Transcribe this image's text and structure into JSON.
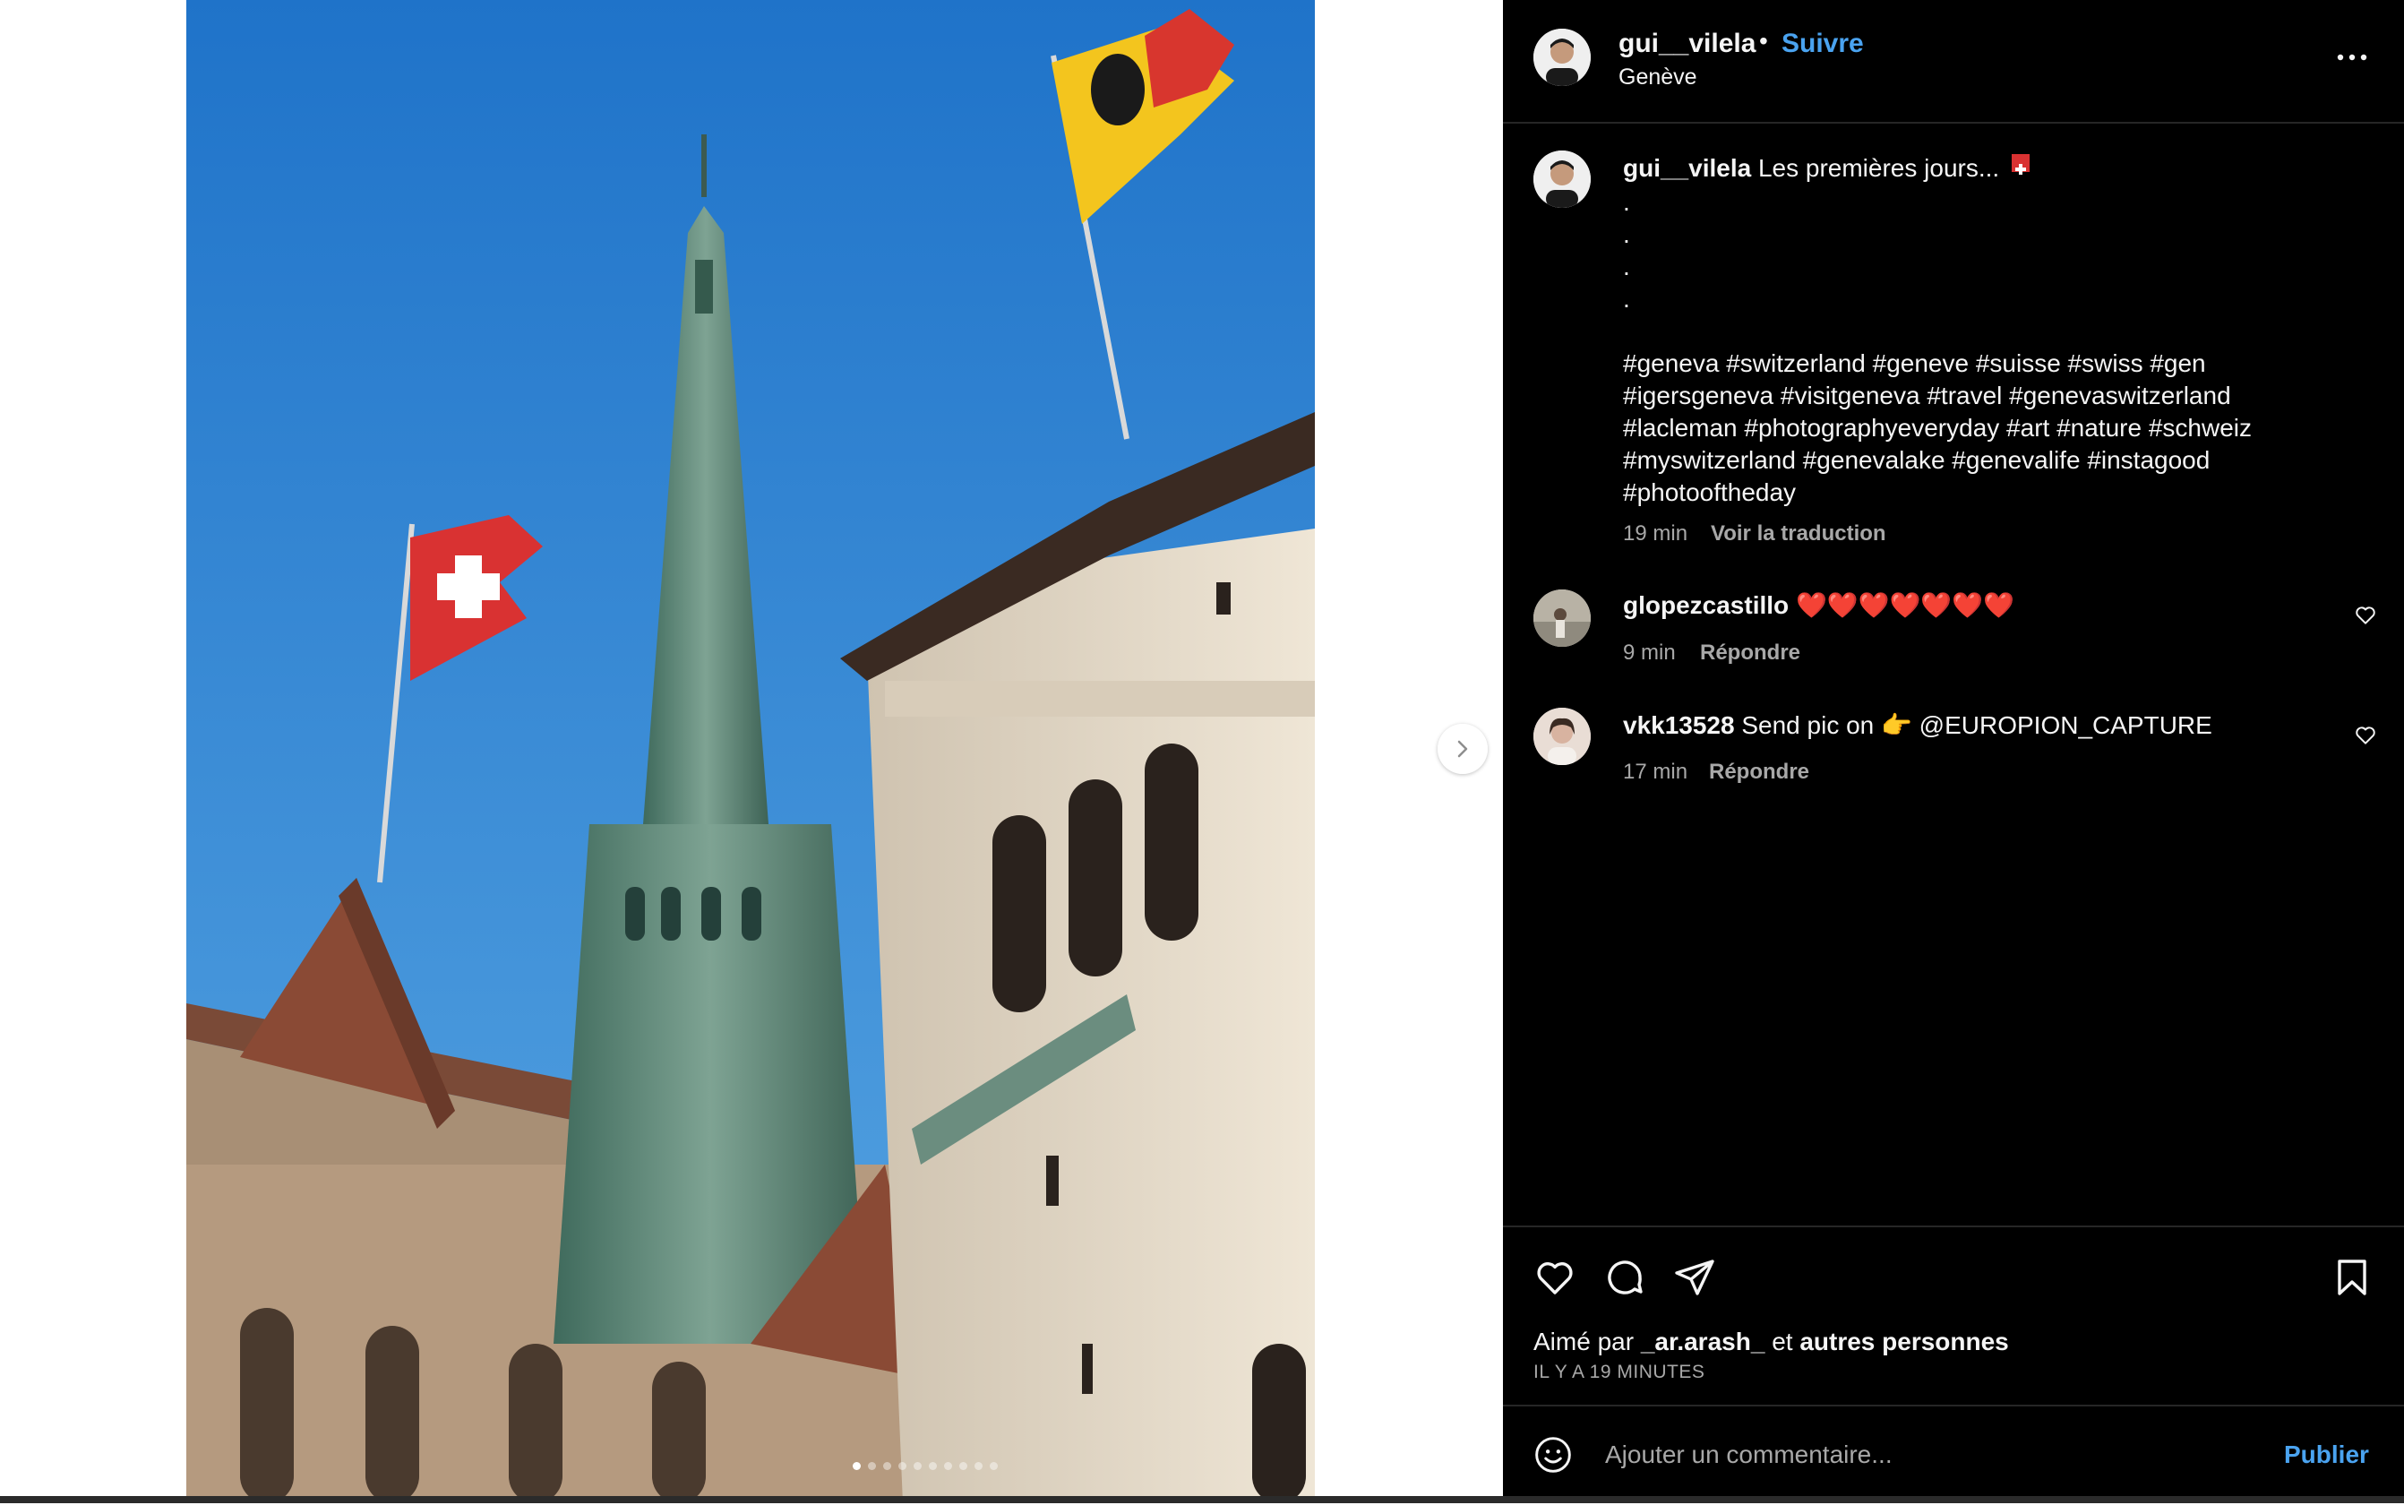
{
  "post": {
    "username": "gui__vilela",
    "separator": "•",
    "follow_label": "Suivre",
    "location": "Genève"
  },
  "caption": {
    "username": "gui__vilela",
    "text": "Les premières jours...",
    "flag_icon": "swiss-flag-emoji",
    "dots": [
      ".",
      ".",
      ".",
      "."
    ],
    "hashtags": [
      "#geneva #switzerland #geneve #suisse #swiss #gen",
      "#igersgeneva #visitgeneva #travel #genevaswitzerland",
      "#lacleman #photographyeveryday #art #nature #schweiz",
      "#myswitzerland #genevalake #genevalife #instagood",
      "#photooftheday"
    ],
    "time": "19 min",
    "translate_label": "Voir la traduction"
  },
  "comments": [
    {
      "username": "glopezcastillo",
      "text": "❤️❤️❤️❤️❤️❤️❤️",
      "time": "9 min",
      "reply_label": "Répondre"
    },
    {
      "username": "vkk13528",
      "text": "Send pic on 👉 @EUROPION_CAPTURE",
      "time": "17 min",
      "reply_label": "Répondre"
    }
  ],
  "likes": {
    "prefix": "Aimé par",
    "user": "_ar.arash_",
    "conjunction": "et",
    "others": "autres personnes"
  },
  "time_ago": "IL Y A 19 MINUTES",
  "comment_box": {
    "placeholder": "Ajouter un commentaire...",
    "publish_label": "Publier"
  },
  "carousel": {
    "slide_count": 10,
    "active_index": 0
  },
  "colors": {
    "accent": "#4aa3f0",
    "background": "#000000",
    "text": "#f5f5f5",
    "muted": "#a8a8a8"
  }
}
